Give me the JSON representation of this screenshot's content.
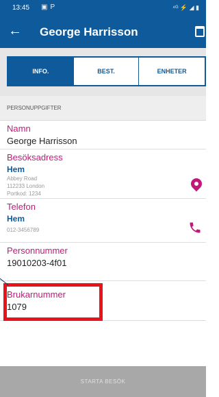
{
  "status_bar": {
    "time": "13:45",
    "right_icons": "⁴ᴳ ⚡ ◢ ▮"
  },
  "app_bar": {
    "title": "George Harrisson"
  },
  "tabs": [
    {
      "label": "INFO.",
      "active": true
    },
    {
      "label": "BEST.",
      "active": false
    },
    {
      "label": "ENHETER",
      "active": false
    }
  ],
  "section_header": "PERSONUPPGIFTER",
  "fields": {
    "namn": {
      "label": "Namn",
      "value": "George Harrisson"
    },
    "besoksadress": {
      "label": "Besöksadress",
      "type": "Hem",
      "lines": [
        "Abbey Road",
        "112233 London",
        "Portkod: 1234"
      ]
    },
    "telefon": {
      "label": "Telefon",
      "type": "Hem",
      "number": "012-3456789"
    },
    "personnummer": {
      "label": "Personnummer",
      "value": "19010203-4f01"
    },
    "brukarnummer": {
      "label": "Brukarnummer",
      "value": "1079"
    }
  },
  "bottom_button": "STARTA BESÖK",
  "colors": {
    "primary": "#0e5a9a",
    "label_magenta": "#c2187a",
    "highlight_red": "#e8141c",
    "button_gray": "#a8a8a8"
  }
}
